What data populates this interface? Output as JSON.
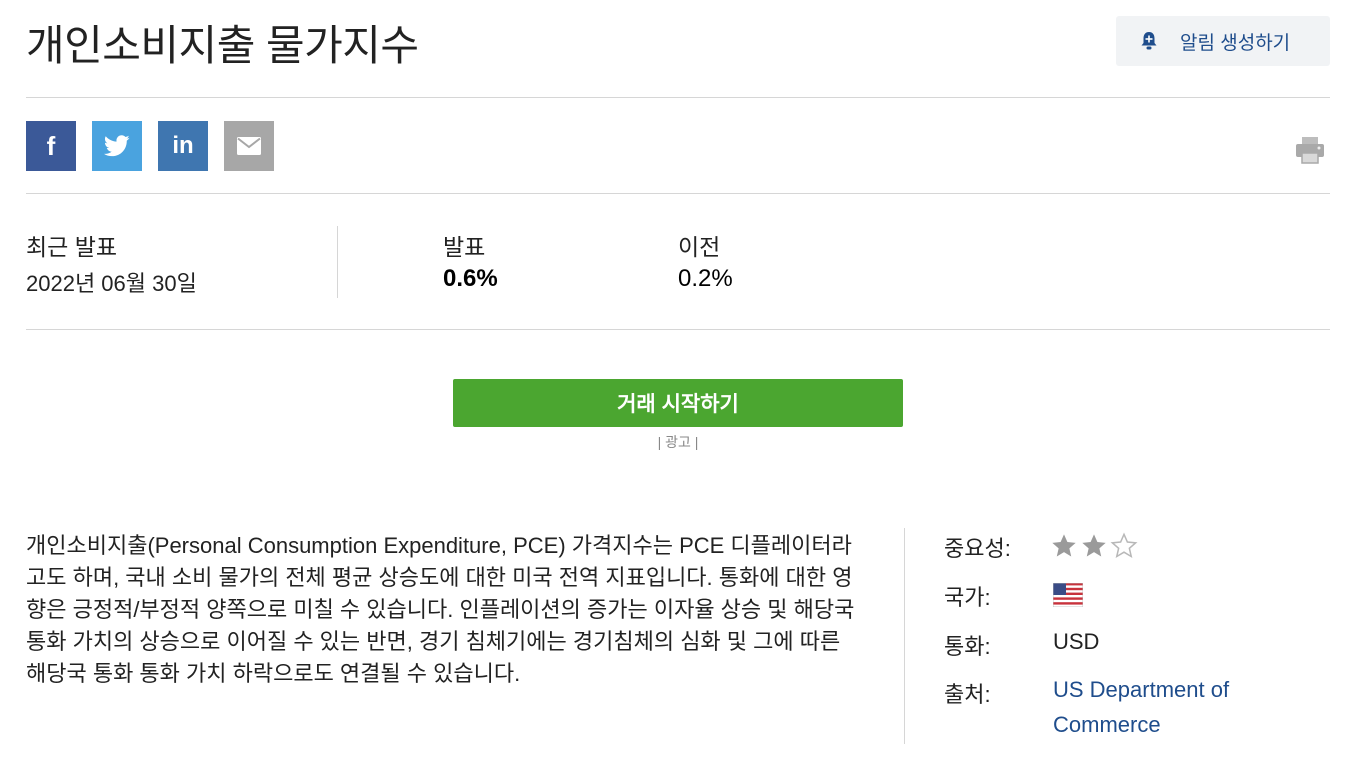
{
  "header": {
    "title": "개인소비지출 물가지수",
    "alert_button_label": "알림 생성하기"
  },
  "share": {
    "facebook_glyph": "f",
    "linkedin_glyph": "in",
    "icons": [
      "facebook-icon",
      "twitter-icon",
      "linkedin-icon",
      "email-icon",
      "print-icon"
    ]
  },
  "release": {
    "latest_label": "최근 발표",
    "latest_date": "2022년 06월 30일",
    "actual_label": "발표",
    "actual_value": "0.6%",
    "previous_label": "이전",
    "previous_value": "0.2%"
  },
  "cta": {
    "trade_label": "거래 시작하기",
    "ad_note": "| 광고 |"
  },
  "description": "개인소비지출(Personal Consumption Expenditure, PCE) 가격지수는 PCE 디플레이터라고도 하며, 국내 소비 물가의 전체 평균 상승도에 대한 미국 전역 지표입니다. 통화에 대한 영향은 긍정적/부정적 양쪽으로 미칠 수 있습니다. 인플레이션의 증가는 이자율 상승 및 해당국 통화 가치의 상승으로 이어질 수 있는 반면, 경기 침체기에는 경기침체의 심화 및 그에 따른 해당국 통화 통화 가치 하락으로도 연결될 수 있습니다.",
  "meta": {
    "importance_label": "중요성:",
    "importance_stars": 2,
    "importance_max": 3,
    "country_label": "국가:",
    "country_flag": "us-flag-icon",
    "currency_label": "통화:",
    "currency_value": "USD",
    "source_label": "출처:",
    "source_value": "US Department of Commerce"
  },
  "colors": {
    "facebook": "#3b5998",
    "twitter": "#4aa3df",
    "linkedin": "#3f76b0",
    "email": "#a7a7a7",
    "trade_button": "#4ba630",
    "link": "#1f4d8c"
  }
}
